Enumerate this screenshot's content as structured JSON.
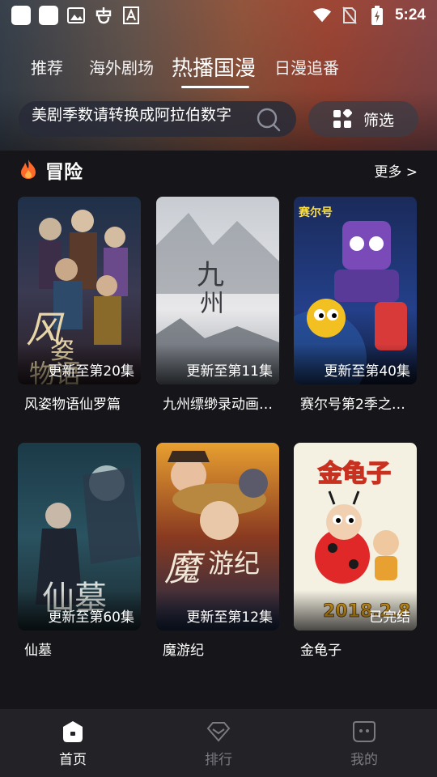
{
  "status_bar": {
    "time": "5:24"
  },
  "tabs": [
    {
      "label": "推荐",
      "active": false
    },
    {
      "label": "海外剧场",
      "active": false
    },
    {
      "label": "热播国漫",
      "active": true
    },
    {
      "label": "日漫追番",
      "active": false
    }
  ],
  "search": {
    "value": "美剧季数请转换成阿拉伯数字"
  },
  "filter": {
    "label": "筛选"
  },
  "section": {
    "title": "冒险",
    "more": "更多 >"
  },
  "cards": [
    {
      "title": "风姿物语仙罗篇",
      "badge": "更新至第20集"
    },
    {
      "title": "九州缥缈录动画…",
      "badge": "更新至第11集"
    },
    {
      "title": "赛尔号第2季之…",
      "badge": "更新至第40集"
    },
    {
      "title": "仙墓",
      "badge": "更新至第60集"
    },
    {
      "title": "魔游纪",
      "badge": "更新至第12集"
    },
    {
      "title": "金龟子",
      "badge": "已完结"
    }
  ],
  "bottom_nav": [
    {
      "label": "首页",
      "icon": "home-icon",
      "active": true
    },
    {
      "label": "排行",
      "icon": "ranking-icon",
      "active": false
    },
    {
      "label": "我的",
      "icon": "profile-icon",
      "active": false
    }
  ],
  "colors": {
    "accent": "#ff6a2a",
    "background": "#16161a",
    "nav_bg": "#222227"
  }
}
